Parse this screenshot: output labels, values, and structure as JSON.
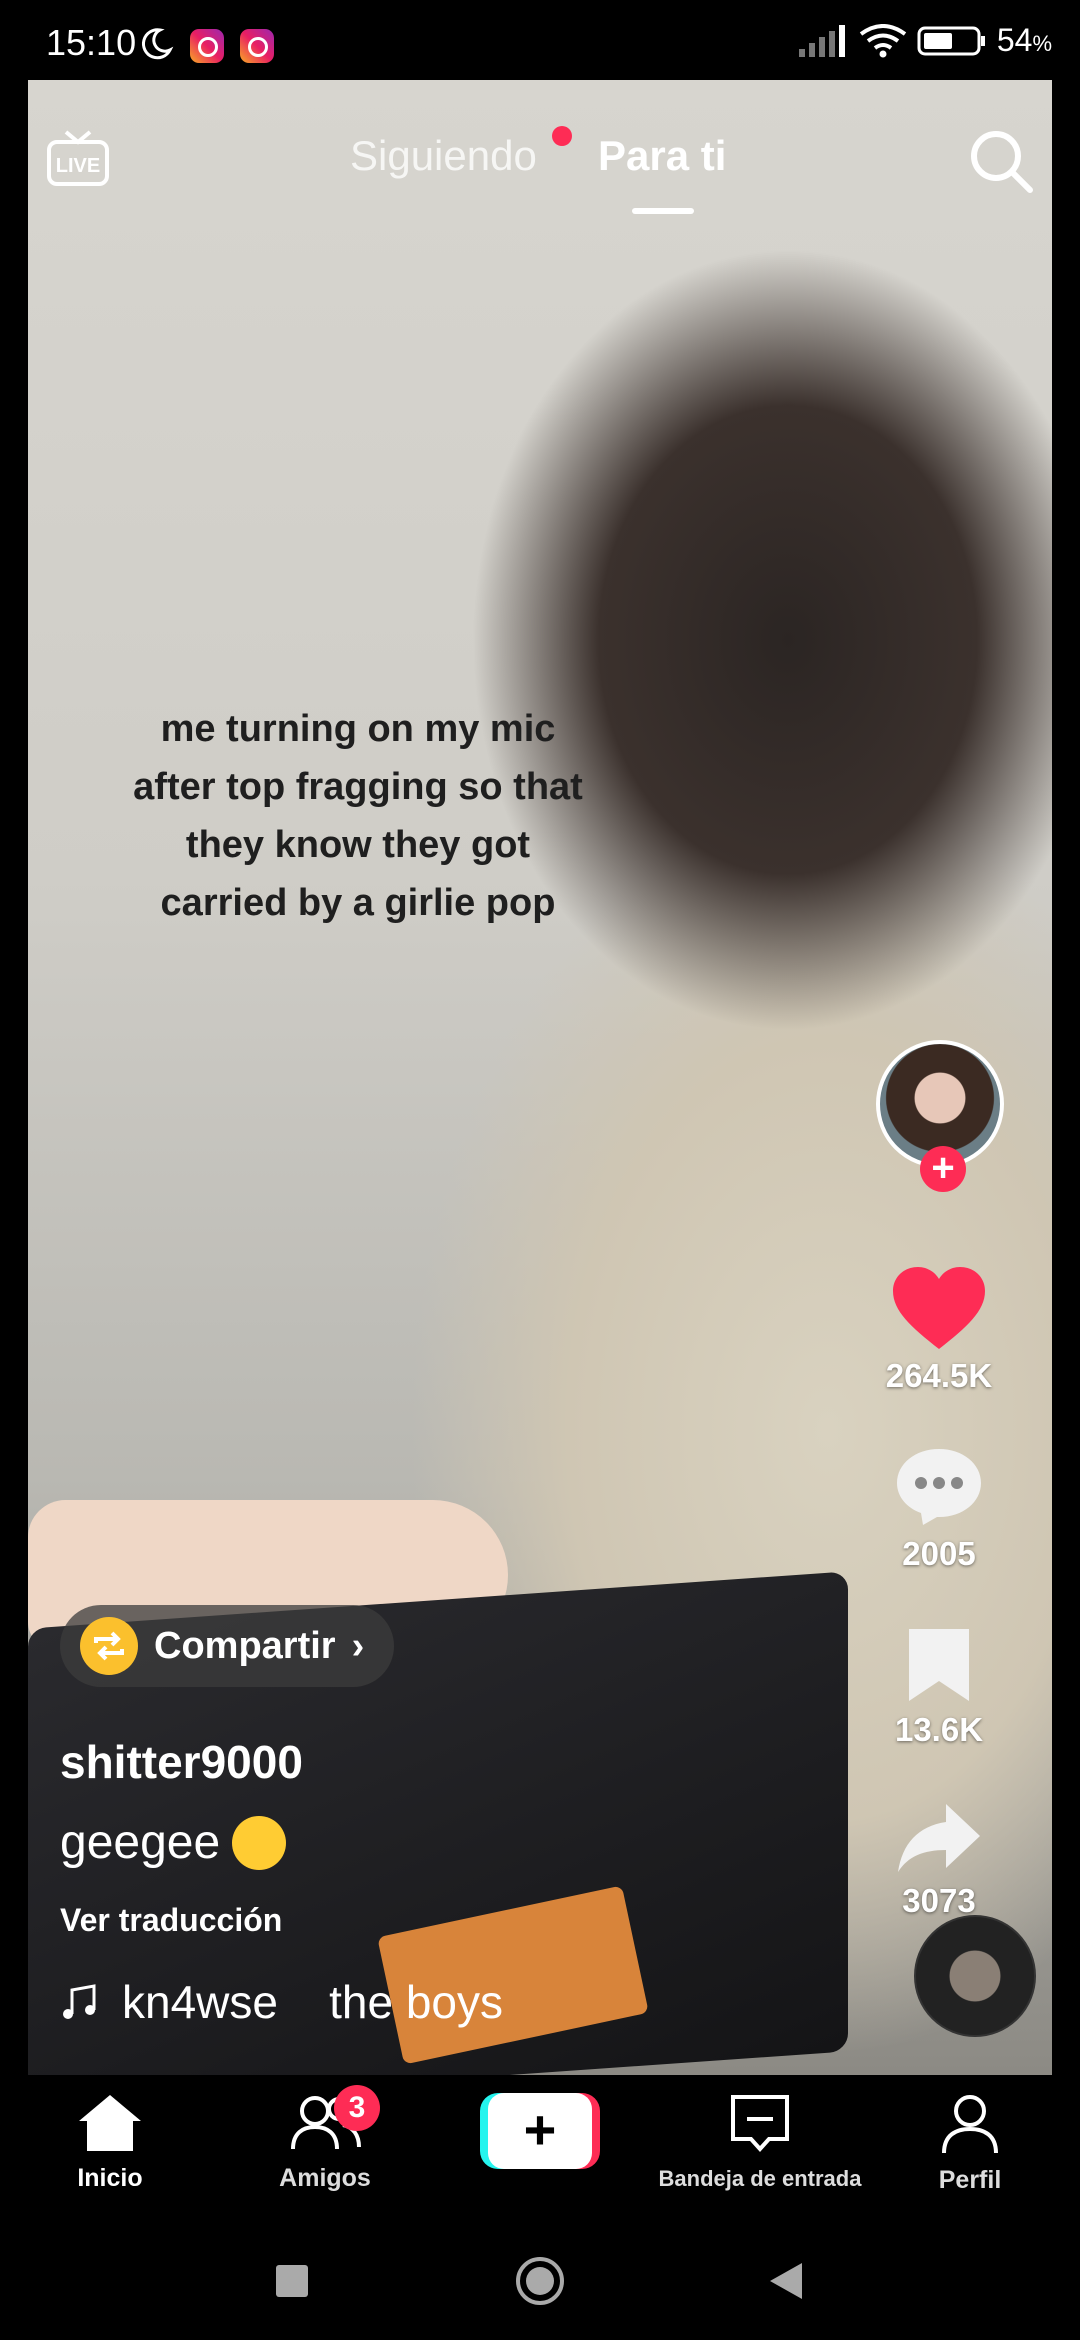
{
  "status_bar": {
    "time": "15:10",
    "battery": "54",
    "battery_unit": "%",
    "icons": [
      "moon-icon",
      "instagram-icon",
      "instagram-icon",
      "signal-icon",
      "wifi-icon",
      "battery-icon"
    ]
  },
  "top_nav": {
    "tabs": [
      {
        "label": "Siguiendo",
        "active": false,
        "has_dot": true
      },
      {
        "label": "Para ti",
        "active": true
      }
    ],
    "live_icon_label": "LIVE"
  },
  "video": {
    "caption_lines": [
      "me turning on my mic",
      "after top fragging so that",
      "they know they got",
      "carried by a girlie pop"
    ],
    "share_label": "Compartir",
    "username": "shitter9000",
    "description": "geegee",
    "translate_label": "Ver traducción",
    "music_text": "kn4wse    the boys"
  },
  "actions": {
    "likes": "264.5K",
    "comments": "2005",
    "saves": "13.6K",
    "shares": "3073"
  },
  "bottom_nav": {
    "items": [
      {
        "label": "Inicio",
        "icon": "home-icon"
      },
      {
        "label": "Amigos",
        "icon": "friends-icon",
        "badge": "3"
      },
      {
        "label": "",
        "icon": "plus-icon"
      },
      {
        "label": "Bandeja de entrada",
        "icon": "inbox-icon"
      },
      {
        "label": "Perfil",
        "icon": "profile-icon"
      }
    ]
  },
  "colors": {
    "accent": "#fe2c55",
    "cyan": "#25f4ee",
    "share_yellow": "#fbc02d"
  }
}
